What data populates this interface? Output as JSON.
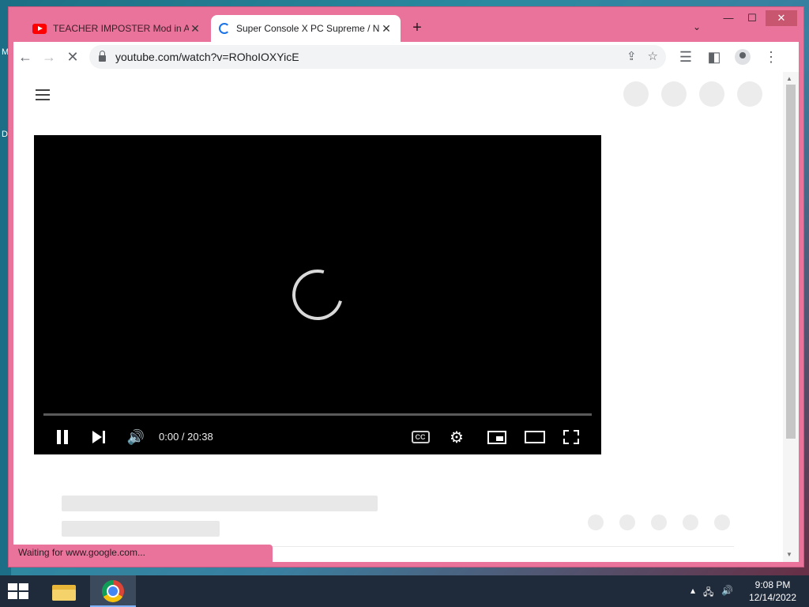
{
  "desktop": {
    "edge_letters": [
      "M",
      "D"
    ]
  },
  "browser": {
    "tabs": [
      {
        "title": "TEACHER IMPOSTER Mod in Am",
        "state": "inactive"
      },
      {
        "title": "Super Console X PC Supreme / N",
        "state": "active"
      }
    ],
    "new_tab_label": "+",
    "address": "youtube.com/watch?v=ROhoIOXYicE",
    "status_text": "Waiting for www.google.com..."
  },
  "player": {
    "time_current": "0:00",
    "time_separator": " / ",
    "time_total": "20:38",
    "cc_label": "CC",
    "progress": 0
  },
  "taskbar": {
    "time": "9:08 PM",
    "date": "12/14/2022"
  },
  "colors": {
    "window_frame": "#e9739b",
    "youtube_red": "#ff0000",
    "player_bg": "#000000"
  }
}
